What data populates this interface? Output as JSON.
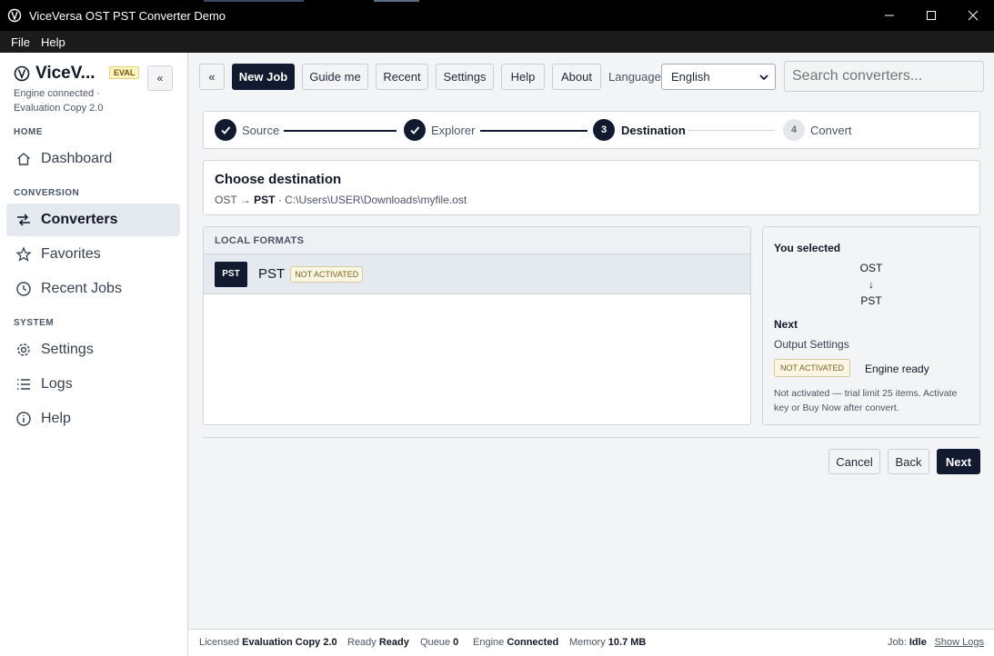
{
  "window": {
    "title": "ViceVersa OST PST Converter Demo"
  },
  "menubar": {
    "items": [
      "File",
      "Help"
    ]
  },
  "sidebar": {
    "brand": "ViceV...",
    "eval_badge": "EVAL",
    "collapse_label": "«",
    "engine_line1": "Engine connected ·",
    "engine_line2": "Evaluation Copy 2.0",
    "sections": {
      "home": "HOME",
      "conversion": "CONVERSION",
      "system": "SYSTEM"
    },
    "items": {
      "dashboard": "Dashboard",
      "converters": "Converters",
      "favorites": "Favorites",
      "recent_jobs": "Recent Jobs",
      "settings": "Settings",
      "logs": "Logs",
      "help": "Help"
    }
  },
  "toolbar": {
    "collapse": "«",
    "new_job": "New Job",
    "guide_me": "Guide me",
    "recent": "Recent",
    "settings": "Settings",
    "help": "Help",
    "about": "About",
    "language_label": "Language",
    "language_value": "English",
    "search_placeholder": "Search converters..."
  },
  "stepper": {
    "steps": [
      {
        "label": "Source",
        "state": "done"
      },
      {
        "label": "Explorer",
        "state": "done"
      },
      {
        "number": "3",
        "label": "Destination",
        "state": "current"
      },
      {
        "number": "4",
        "label": "Convert",
        "state": "pending"
      }
    ]
  },
  "destination": {
    "title": "Choose destination",
    "from": "OST",
    "arrow": "→",
    "to": "PST",
    "path": "· C:\\Users\\USER\\Downloads\\myfile.ost"
  },
  "formats": {
    "header": "LOCAL FORMATS",
    "items": [
      {
        "icon": "PST",
        "name": "PST",
        "badge": "NOT ACTIVATED"
      }
    ]
  },
  "summary": {
    "title": "You selected",
    "from": "OST",
    "arrow": "↓",
    "to": "PST",
    "next_label": "Next",
    "next_value": "Output Settings",
    "badge": "NOT ACTIVATED",
    "engine": "Engine ready",
    "note": "Not activated — trial limit 25 items. Activate key or Buy Now after convert."
  },
  "actions": {
    "cancel": "Cancel",
    "back": "Back",
    "next": "Next"
  },
  "statusbar": {
    "licensed_label": "Licensed",
    "licensed_value": "Evaluation Copy 2.0",
    "ready_label": "Ready",
    "ready_value": "Ready",
    "queue_label": "Queue",
    "queue_value": "0",
    "engine_label": "Engine",
    "engine_value": "Connected",
    "memory_label": "Memory",
    "memory_value": "10.7 MB",
    "job_label": "Job:",
    "job_value": "Idle",
    "show_logs": "Show Logs"
  },
  "colors": {
    "accent": "#111a2e",
    "active_nav": "#e5e9f0",
    "badge_bg": "#fbf6e3"
  }
}
